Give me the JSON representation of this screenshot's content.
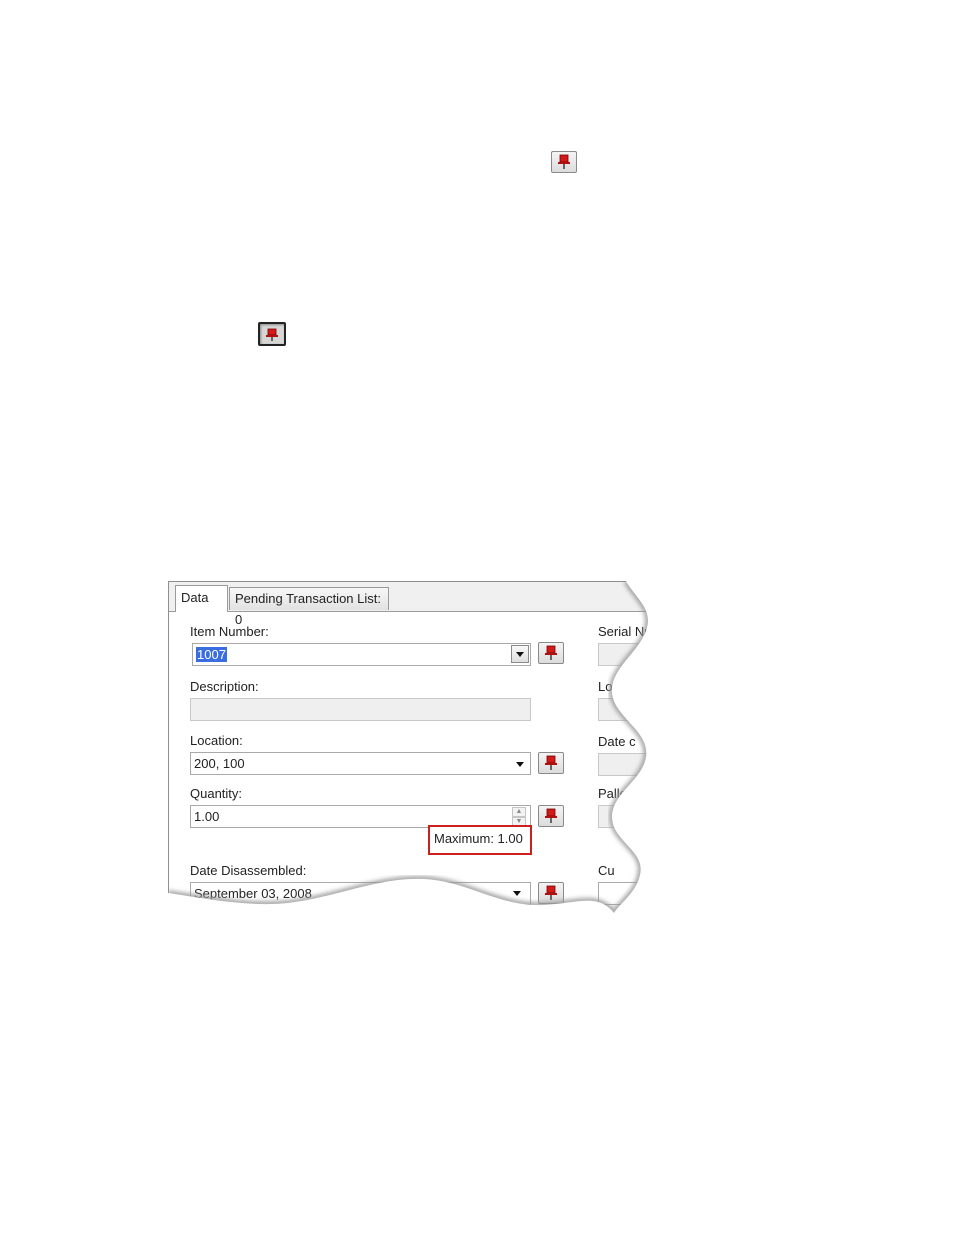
{
  "doc_icons": {
    "pin_unpinned": "pushpin-icon",
    "pin_pinned": "pushpin-pressed-icon"
  },
  "form": {
    "tabs": [
      {
        "label": "Data",
        "active": true
      },
      {
        "label": "Pending Transaction List: 0",
        "active": false
      }
    ],
    "item_number": {
      "label": "Item Number:",
      "value": "1007"
    },
    "description": {
      "label": "Description:",
      "value": ""
    },
    "location": {
      "label": "Location:",
      "value": "200, 100"
    },
    "quantity": {
      "label": "Quantity:",
      "value": "1.00"
    },
    "maximum_note": "Maximum: 1.00",
    "date_disassembled": {
      "label": "Date Disassembled:",
      "value": "September 03, 2008"
    },
    "right_column": {
      "serial_label": "Serial Nu",
      "lot_label": "Lo",
      "date_label": "Date c",
      "pallet_label": "Pallet:",
      "cu_label": "Cu"
    },
    "colors": {
      "highlight_box": "#cc1f1f",
      "pin_red": "#d11a1a",
      "selection": "#3a6ee0"
    }
  }
}
